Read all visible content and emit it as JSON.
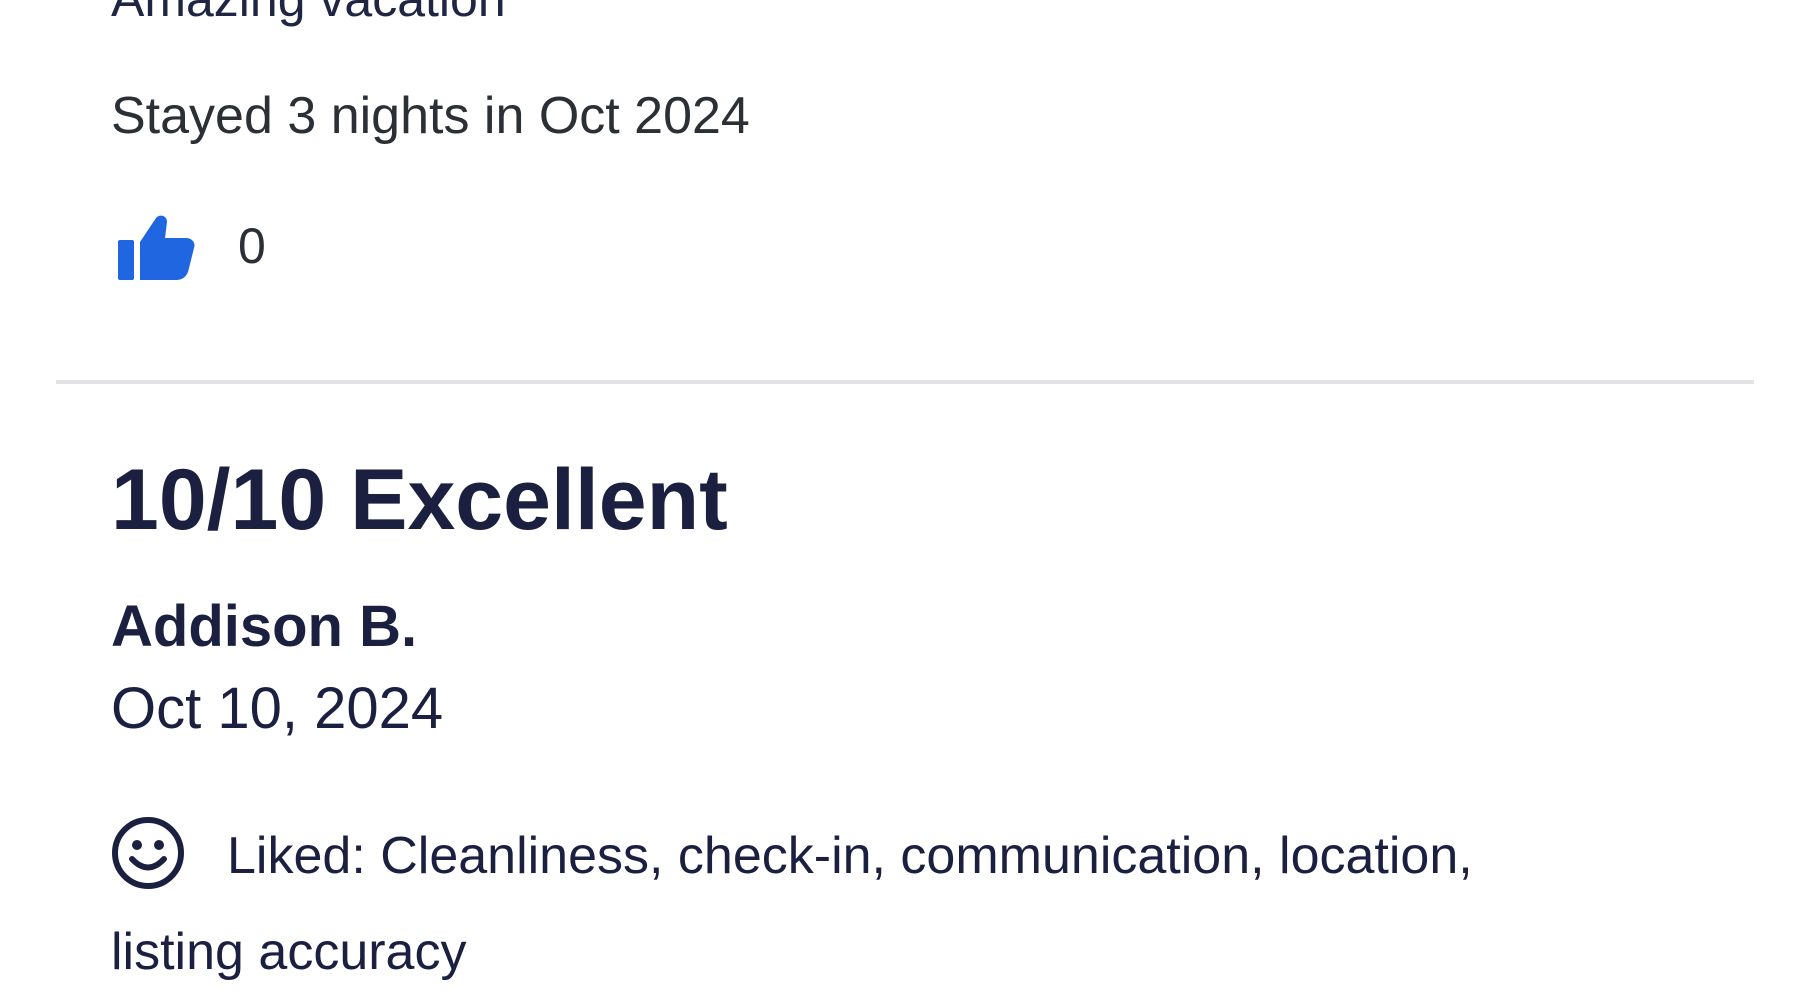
{
  "colors": {
    "text_primary": "#1b2040",
    "text_secondary": "#2b2f36",
    "accent_blue": "#1f66e0",
    "divider": "#e3e4e8"
  },
  "previous_review": {
    "title": "Amazing vacation",
    "stay_info": "Stayed 3 nights in Oct 2024",
    "like_icon": "thumbs-up-icon",
    "like_count": "0"
  },
  "review": {
    "rating_label": "10/10 Excellent",
    "reviewer_name": "Addison B.",
    "date": "Oct 10, 2024",
    "liked_icon": "smiley-face-icon",
    "liked_text": "Liked: Cleanliness, check-in, communication, location, listing accuracy"
  }
}
